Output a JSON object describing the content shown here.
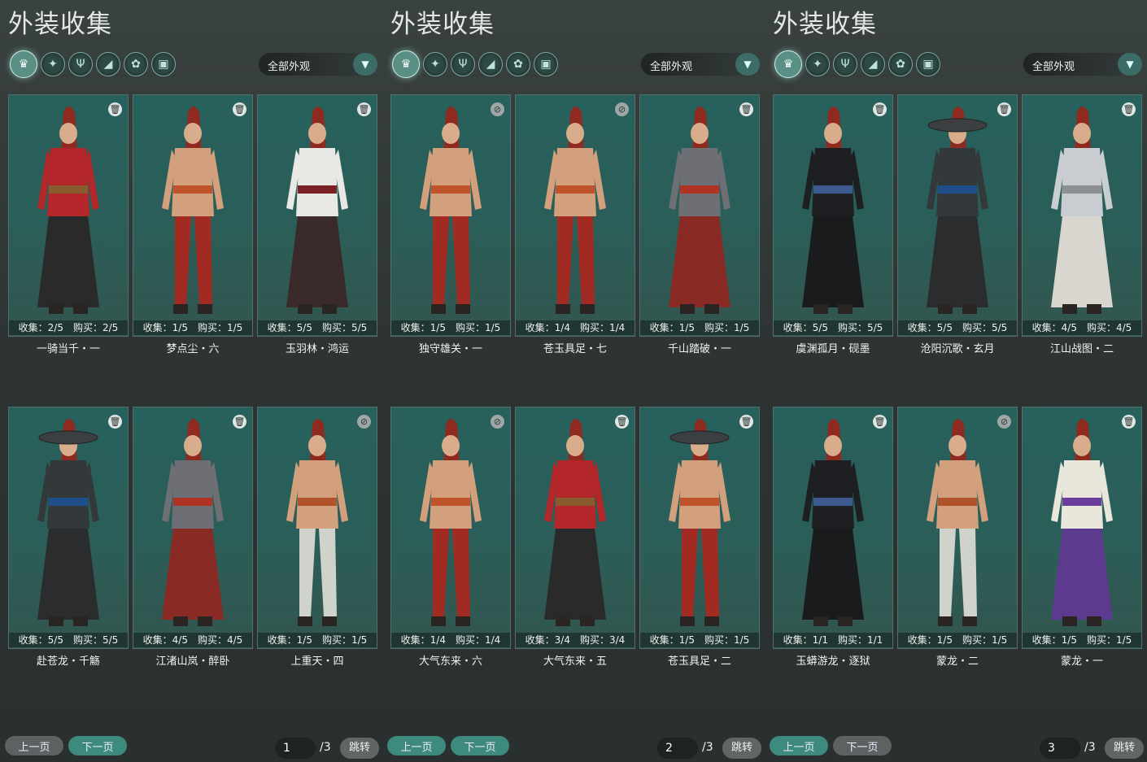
{
  "panels": [
    {
      "title": "外装收集",
      "filter_label": "全部外观",
      "prev_label": "上一页",
      "next_label": "下一页",
      "page_current": "1",
      "page_total": "/3",
      "jump_label": "跳转",
      "next_active": true,
      "cards": [
        {
          "stat": "收集：2/5　购买：2/5",
          "name": "一骑当千・一",
          "outfit": "red-robe",
          "disabled": false
        },
        {
          "stat": "收集：1/5　购买：1/5",
          "name": "梦点尘・六",
          "outfit": "bare-red",
          "disabled": false
        },
        {
          "stat": "收集：5/5　购买：5/5",
          "name": "玉羽林・鸿运",
          "outfit": "white-robe",
          "disabled": false
        },
        {
          "stat": "收集：5/5　购买：5/5",
          "name": "赴苍龙・千觞",
          "outfit": "dark-hat",
          "disabled": false
        },
        {
          "stat": "收集：4/5　购买：4/5",
          "name": "江渚山岚・醉卧",
          "outfit": "armor-red",
          "disabled": false
        },
        {
          "stat": "收集：1/5　购买：1/5",
          "name": "上重天・四",
          "outfit": "bare-white",
          "disabled": true
        }
      ]
    },
    {
      "title": "外装收集",
      "filter_label": "全部外观",
      "prev_label": "上一页",
      "next_label": "下一页",
      "page_current": "2",
      "page_total": "/3",
      "jump_label": "跳转",
      "next_active": true,
      "prev_active": true,
      "cards": [
        {
          "stat": "收集：1/5　购买：1/5",
          "name": "独守雄关・一",
          "outfit": "bare-red",
          "disabled": true
        },
        {
          "stat": "收集：1/4　购买：1/4",
          "name": "苍玉具足・七",
          "outfit": "bare-red",
          "disabled": true
        },
        {
          "stat": "收集：1/5　购买：1/5",
          "name": "千山踏破・一",
          "outfit": "armor-red",
          "disabled": false
        },
        {
          "stat": "收集：1/4　购买：1/4",
          "name": "大气东来・六",
          "outfit": "bare-red",
          "disabled": true
        },
        {
          "stat": "收集：3/4　购买：3/4",
          "name": "大气东来・五",
          "outfit": "red-robe",
          "disabled": false
        },
        {
          "stat": "收集：1/5　购买：1/5",
          "name": "苍玉具足・二",
          "outfit": "bare-hat",
          "disabled": false
        }
      ]
    },
    {
      "title": "外装收集",
      "filter_label": "全部外观",
      "prev_label": "上一页",
      "next_label": "下一页",
      "page_current": "3",
      "page_total": "/3",
      "jump_label": "跳转",
      "prev_active": true,
      "cards": [
        {
          "stat": "收集：5/5　购买：5/5",
          "name": "虞渊孤月・砚墨",
          "outfit": "black-robe",
          "disabled": false
        },
        {
          "stat": "收集：5/5　购买：5/5",
          "name": "沧阳沉歌・玄月",
          "outfit": "dark-hat",
          "disabled": false
        },
        {
          "stat": "收集：4/5　购买：4/5",
          "name": "江山战图・二",
          "outfit": "white-armor",
          "disabled": false
        },
        {
          "stat": "收集：1/1　购买：1/1",
          "name": "玉蟒游龙・逐狱",
          "outfit": "black-robe",
          "disabled": false
        },
        {
          "stat": "收集：1/5　购买：1/5",
          "name": "蒙龙・二",
          "outfit": "bare-white",
          "disabled": true
        },
        {
          "stat": "收集：1/5　购买：1/5",
          "name": "蒙龙・一",
          "outfit": "white-purple",
          "disabled": false
        }
      ]
    }
  ],
  "category_icons": [
    "outfit-icon",
    "jacket-icon",
    "pants-icon",
    "boots-icon",
    "bracers-icon",
    "belt-icon"
  ],
  "colors": {
    "accent": "#3f8a7e",
    "card_bg": "#2b5e58",
    "panel_bg": "#2d3433"
  }
}
